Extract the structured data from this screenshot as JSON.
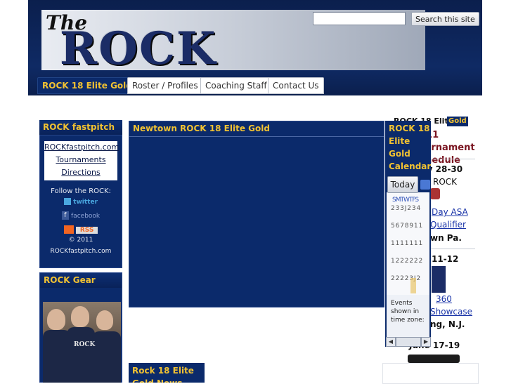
{
  "header": {
    "logo_the": "The",
    "logo_rock": "ROCK",
    "search_placeholder": "",
    "search_button": "Search this site"
  },
  "nav": {
    "items": [
      {
        "label": "ROCK 18 Elite Gold",
        "active": true
      },
      {
        "label": "Roster / Profiles",
        "active": false
      },
      {
        "label": "Coaching Staff",
        "active": false
      },
      {
        "label": "Contact Us",
        "active": false
      }
    ]
  },
  "left": {
    "fastpitch_title": "ROCK fastpitch",
    "links": [
      "ROCKfastpitch.com",
      "Tournaments",
      "Directions"
    ],
    "follow": "Follow the ROCK:",
    "twitter": "twitter",
    "facebook": "facebook",
    "rss": "RSS",
    "copyright": "© 2011",
    "copyright_site": "ROCKfastpitch.com",
    "gear_title": "ROCK Gear",
    "gear_shirt": "ROCK"
  },
  "main": {
    "title": "Newtown ROCK 18 Elite Gold",
    "news_title": "Rock 18 Elite Gold News"
  },
  "calendar": {
    "title": "ROCK 18 Elite Gold Calendar",
    "today": "Today",
    "weekdays": "SMTWTFS",
    "rows": [
      "2 3 3 J 2 3 4",
      "5 6 7 8 9 1 1",
      "1 1 1 1 1 1 1",
      "1 2 2 2 2 2 2",
      "2 2 2 2 3 J 2"
    ],
    "events_note": "Events shown in time zone:"
  },
  "schedule": {
    "heading": "ROCK 18 Elite",
    "heading_badge": "Gold",
    "subtitle": "2011 Tournament Schedule",
    "e1_date": "May 28-30",
    "e1_org": "ROCK",
    "e1_link1": "Day ASA",
    "e1_link2": "Qualifier",
    "e1_place": "wn Pa.",
    "e2_date": "11-12",
    "e2_link1": "360",
    "e2_link2": "Showcase",
    "e2_place": "ng, N.J.",
    "e3_date": "June 17-19"
  },
  "colors": {
    "navy": "#0b2a6b",
    "gold": "#f1c232",
    "link": "#1a34a8",
    "maroon": "#7a1420"
  }
}
